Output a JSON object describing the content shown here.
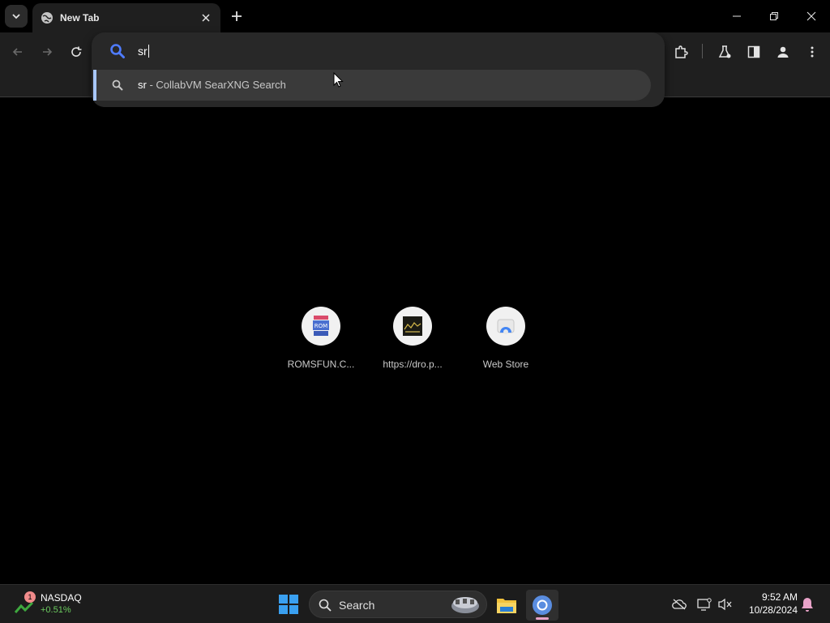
{
  "browser": {
    "tab_title": "New Tab",
    "omnibox_text": "sr",
    "suggestion": {
      "bold": "sr",
      "rest": " - CollabVM SearXNG Search"
    }
  },
  "shortcuts": [
    {
      "label": "ROMSFUN.C..."
    },
    {
      "label": "https://dro.p..."
    },
    {
      "label": "Web Store"
    }
  ],
  "taskbar": {
    "widget_badge": "1",
    "widget_name": "NASDAQ",
    "widget_change": "+0.51%",
    "search_label": "Search",
    "time": "9:52 AM",
    "date": "10/28/2024"
  },
  "colors": {
    "accent": "#a8c7fa",
    "search_icon_blue": "#4f7cff",
    "stock_green": "#6ccb5f"
  }
}
